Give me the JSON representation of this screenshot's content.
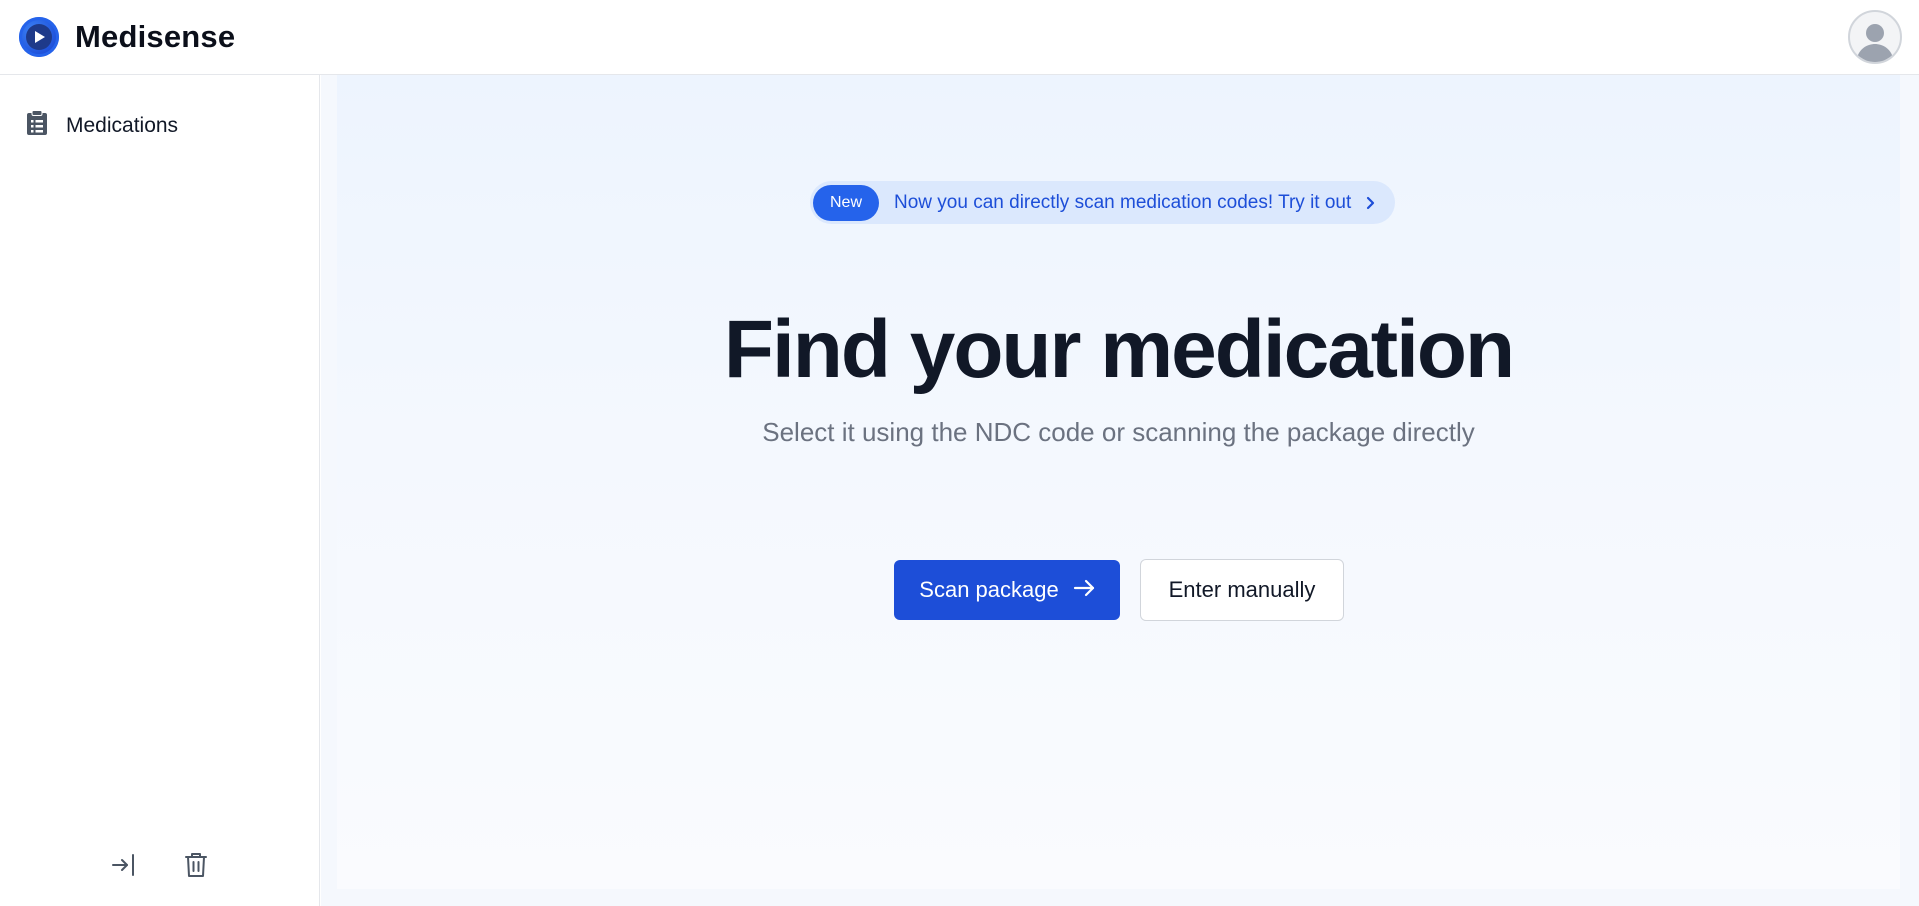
{
  "header": {
    "app_title": "Medisense",
    "logo_icon": "play-logo-icon",
    "avatar_icon": "user-avatar-icon"
  },
  "sidebar": {
    "items": [
      {
        "label": "Medications",
        "icon": "clipboard-list-icon"
      }
    ],
    "actions": [
      {
        "icon": "sign-in-icon"
      },
      {
        "icon": "trash-icon"
      }
    ]
  },
  "main": {
    "announcement": {
      "badge": "New",
      "text": "Now you can directly scan medication codes! Try it out",
      "icon": "chevron-right-icon"
    },
    "headline": "Find your medication",
    "subheadline": "Select it using the NDC code or scanning the package directly",
    "primary_button": {
      "label": "Scan package",
      "icon": "arrow-right-icon"
    },
    "secondary_button": {
      "label": "Enter manually"
    }
  },
  "colors": {
    "accent": "#1d4ed8",
    "badge": "#2563eb",
    "announce_bg": "#dbe8fd",
    "text_muted": "#6b7280"
  }
}
